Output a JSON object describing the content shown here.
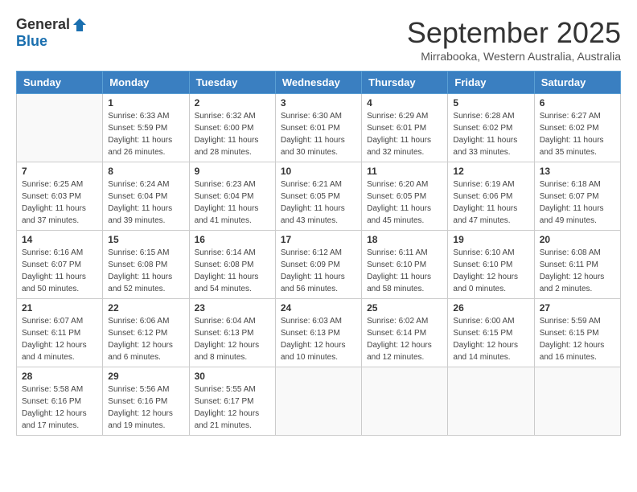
{
  "header": {
    "logo_general": "General",
    "logo_blue": "Blue",
    "month_title": "September 2025",
    "subtitle": "Mirrabooka, Western Australia, Australia"
  },
  "days_of_week": [
    "Sunday",
    "Monday",
    "Tuesday",
    "Wednesday",
    "Thursday",
    "Friday",
    "Saturday"
  ],
  "weeks": [
    [
      {
        "day": "",
        "info": ""
      },
      {
        "day": "1",
        "info": "Sunrise: 6:33 AM\nSunset: 5:59 PM\nDaylight: 11 hours\nand 26 minutes."
      },
      {
        "day": "2",
        "info": "Sunrise: 6:32 AM\nSunset: 6:00 PM\nDaylight: 11 hours\nand 28 minutes."
      },
      {
        "day": "3",
        "info": "Sunrise: 6:30 AM\nSunset: 6:01 PM\nDaylight: 11 hours\nand 30 minutes."
      },
      {
        "day": "4",
        "info": "Sunrise: 6:29 AM\nSunset: 6:01 PM\nDaylight: 11 hours\nand 32 minutes."
      },
      {
        "day": "5",
        "info": "Sunrise: 6:28 AM\nSunset: 6:02 PM\nDaylight: 11 hours\nand 33 minutes."
      },
      {
        "day": "6",
        "info": "Sunrise: 6:27 AM\nSunset: 6:02 PM\nDaylight: 11 hours\nand 35 minutes."
      }
    ],
    [
      {
        "day": "7",
        "info": "Sunrise: 6:25 AM\nSunset: 6:03 PM\nDaylight: 11 hours\nand 37 minutes."
      },
      {
        "day": "8",
        "info": "Sunrise: 6:24 AM\nSunset: 6:04 PM\nDaylight: 11 hours\nand 39 minutes."
      },
      {
        "day": "9",
        "info": "Sunrise: 6:23 AM\nSunset: 6:04 PM\nDaylight: 11 hours\nand 41 minutes."
      },
      {
        "day": "10",
        "info": "Sunrise: 6:21 AM\nSunset: 6:05 PM\nDaylight: 11 hours\nand 43 minutes."
      },
      {
        "day": "11",
        "info": "Sunrise: 6:20 AM\nSunset: 6:05 PM\nDaylight: 11 hours\nand 45 minutes."
      },
      {
        "day": "12",
        "info": "Sunrise: 6:19 AM\nSunset: 6:06 PM\nDaylight: 11 hours\nand 47 minutes."
      },
      {
        "day": "13",
        "info": "Sunrise: 6:18 AM\nSunset: 6:07 PM\nDaylight: 11 hours\nand 49 minutes."
      }
    ],
    [
      {
        "day": "14",
        "info": "Sunrise: 6:16 AM\nSunset: 6:07 PM\nDaylight: 11 hours\nand 50 minutes."
      },
      {
        "day": "15",
        "info": "Sunrise: 6:15 AM\nSunset: 6:08 PM\nDaylight: 11 hours\nand 52 minutes."
      },
      {
        "day": "16",
        "info": "Sunrise: 6:14 AM\nSunset: 6:08 PM\nDaylight: 11 hours\nand 54 minutes."
      },
      {
        "day": "17",
        "info": "Sunrise: 6:12 AM\nSunset: 6:09 PM\nDaylight: 11 hours\nand 56 minutes."
      },
      {
        "day": "18",
        "info": "Sunrise: 6:11 AM\nSunset: 6:10 PM\nDaylight: 11 hours\nand 58 minutes."
      },
      {
        "day": "19",
        "info": "Sunrise: 6:10 AM\nSunset: 6:10 PM\nDaylight: 12 hours\nand 0 minutes."
      },
      {
        "day": "20",
        "info": "Sunrise: 6:08 AM\nSunset: 6:11 PM\nDaylight: 12 hours\nand 2 minutes."
      }
    ],
    [
      {
        "day": "21",
        "info": "Sunrise: 6:07 AM\nSunset: 6:11 PM\nDaylight: 12 hours\nand 4 minutes."
      },
      {
        "day": "22",
        "info": "Sunrise: 6:06 AM\nSunset: 6:12 PM\nDaylight: 12 hours\nand 6 minutes."
      },
      {
        "day": "23",
        "info": "Sunrise: 6:04 AM\nSunset: 6:13 PM\nDaylight: 12 hours\nand 8 minutes."
      },
      {
        "day": "24",
        "info": "Sunrise: 6:03 AM\nSunset: 6:13 PM\nDaylight: 12 hours\nand 10 minutes."
      },
      {
        "day": "25",
        "info": "Sunrise: 6:02 AM\nSunset: 6:14 PM\nDaylight: 12 hours\nand 12 minutes."
      },
      {
        "day": "26",
        "info": "Sunrise: 6:00 AM\nSunset: 6:15 PM\nDaylight: 12 hours\nand 14 minutes."
      },
      {
        "day": "27",
        "info": "Sunrise: 5:59 AM\nSunset: 6:15 PM\nDaylight: 12 hours\nand 16 minutes."
      }
    ],
    [
      {
        "day": "28",
        "info": "Sunrise: 5:58 AM\nSunset: 6:16 PM\nDaylight: 12 hours\nand 17 minutes."
      },
      {
        "day": "29",
        "info": "Sunrise: 5:56 AM\nSunset: 6:16 PM\nDaylight: 12 hours\nand 19 minutes."
      },
      {
        "day": "30",
        "info": "Sunrise: 5:55 AM\nSunset: 6:17 PM\nDaylight: 12 hours\nand 21 minutes."
      },
      {
        "day": "",
        "info": ""
      },
      {
        "day": "",
        "info": ""
      },
      {
        "day": "",
        "info": ""
      },
      {
        "day": "",
        "info": ""
      }
    ]
  ]
}
